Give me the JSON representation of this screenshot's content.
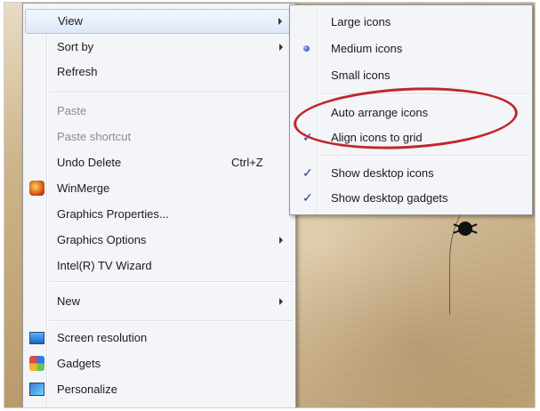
{
  "context_menu": {
    "items": [
      {
        "label": "View"
      },
      {
        "label": "Sort by"
      },
      {
        "label": "Refresh"
      },
      {
        "label": "Paste"
      },
      {
        "label": "Paste shortcut"
      },
      {
        "label": "Undo Delete",
        "shortcut": "Ctrl+Z"
      },
      {
        "label": "WinMerge",
        "icon": "winmerge-icon"
      },
      {
        "label": "Graphics Properties..."
      },
      {
        "label": "Graphics Options"
      },
      {
        "label": "Intel(R) TV Wizard"
      },
      {
        "label": "New"
      },
      {
        "label": "Screen resolution",
        "icon": "screen-resolution-icon"
      },
      {
        "label": "Gadgets",
        "icon": "gadgets-icon"
      },
      {
        "label": "Personalize",
        "icon": "personalize-icon"
      }
    ]
  },
  "view_submenu": {
    "items": [
      {
        "label": "Large icons"
      },
      {
        "label": "Medium icons",
        "state": "selected-radio"
      },
      {
        "label": "Small icons"
      },
      {
        "label": "Auto arrange icons"
      },
      {
        "label": "Align icons to grid",
        "state": "checked"
      },
      {
        "label": "Show desktop icons",
        "state": "checked"
      },
      {
        "label": "Show desktop gadgets",
        "state": "checked"
      }
    ]
  },
  "annotation": {
    "color": "#c0272d",
    "highlights": "Auto arrange icons"
  }
}
